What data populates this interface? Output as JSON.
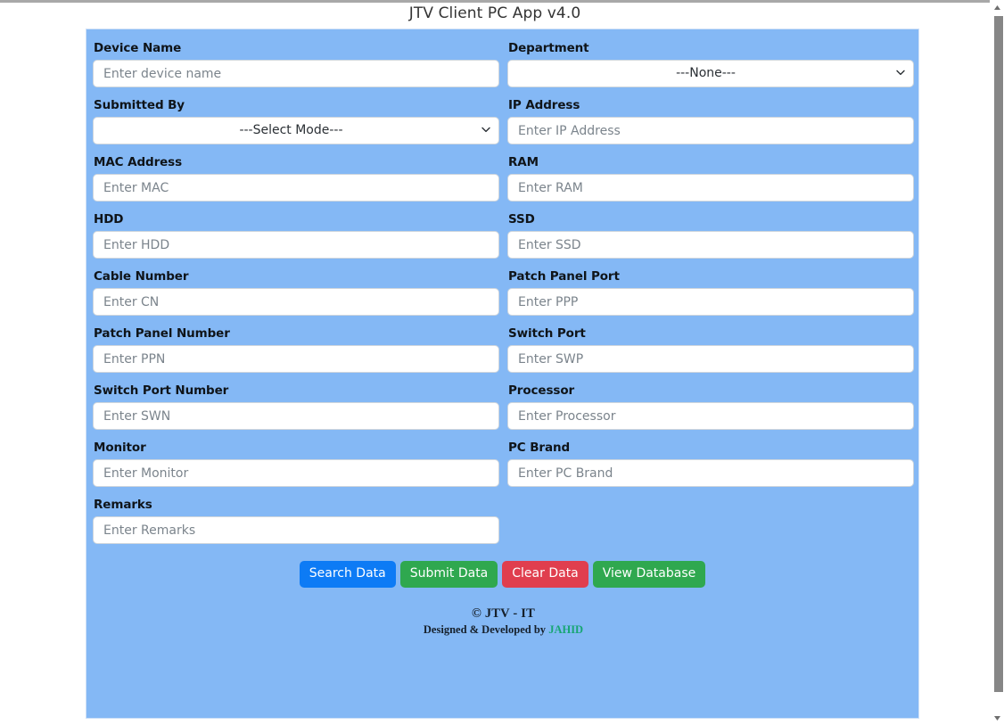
{
  "window": {
    "title": "JTV Client PC App v4.0"
  },
  "form": {
    "rows": [
      {
        "left": {
          "label": "Device Name",
          "type": "input",
          "placeholder": "Enter device name",
          "value": ""
        },
        "right": {
          "label": "Department",
          "type": "select",
          "selected": "---None---"
        }
      },
      {
        "left": {
          "label": "Submitted By",
          "type": "select",
          "selected": "---Select Mode---"
        },
        "right": {
          "label": "IP Address",
          "type": "input",
          "placeholder": "Enter IP Address",
          "value": ""
        }
      },
      {
        "left": {
          "label": "MAC Address",
          "type": "input",
          "placeholder": "Enter MAC",
          "value": ""
        },
        "right": {
          "label": "RAM",
          "type": "input",
          "placeholder": "Enter RAM",
          "value": ""
        }
      },
      {
        "left": {
          "label": "HDD",
          "type": "input",
          "placeholder": "Enter HDD",
          "value": ""
        },
        "right": {
          "label": "SSD",
          "type": "input",
          "placeholder": "Enter SSD",
          "value": ""
        }
      },
      {
        "left": {
          "label": "Cable Number",
          "type": "input",
          "placeholder": "Enter CN",
          "value": ""
        },
        "right": {
          "label": "Patch Panel Port",
          "type": "input",
          "placeholder": "Enter PPP",
          "value": ""
        }
      },
      {
        "left": {
          "label": "Patch Panel Number",
          "type": "input",
          "placeholder": "Enter PPN",
          "value": ""
        },
        "right": {
          "label": "Switch Port",
          "type": "input",
          "placeholder": "Enter SWP",
          "value": ""
        }
      },
      {
        "left": {
          "label": "Switch Port Number",
          "type": "input",
          "placeholder": "Enter SWN",
          "value": ""
        },
        "right": {
          "label": "Processor",
          "type": "input",
          "placeholder": "Enter Processor",
          "value": ""
        }
      },
      {
        "left": {
          "label": "Monitor",
          "type": "input",
          "placeholder": "Enter Monitor",
          "value": ""
        },
        "right": {
          "label": "PC Brand",
          "type": "input",
          "placeholder": "Enter PC Brand",
          "value": ""
        }
      },
      {
        "left": {
          "label": "Remarks",
          "type": "input",
          "placeholder": "Enter Remarks",
          "value": ""
        },
        "right": null
      }
    ]
  },
  "buttons": [
    {
      "label": "Search Data",
      "color": "#0d7bf5"
    },
    {
      "label": "Submit Data",
      "color": "#2fa84f"
    },
    {
      "label": "Clear Data",
      "color": "#e03e4e"
    },
    {
      "label": "View Database",
      "color": "#2fa84f"
    }
  ],
  "footer": {
    "copyright": "© JTV - IT",
    "credit_prefix": "Designed & Developed by ",
    "author": "JAHID",
    "author_color": "#17a673"
  },
  "theme": {
    "panel_background": "#84b8f5",
    "input_background": "#ffffff",
    "label_color": "#0f1419"
  },
  "scrollbar": {
    "up_arrow": "scroll-up-arrow",
    "down_arrow": "scroll-down-arrow"
  }
}
